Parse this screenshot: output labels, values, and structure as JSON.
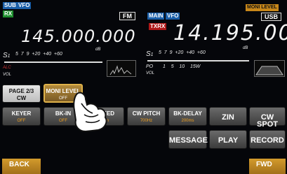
{
  "top": {
    "sub_label": "SUB",
    "sub_vfo": "VFO",
    "rx": "RX",
    "mode": "FM",
    "main_label": "MAIN",
    "main_vfo": "VFO",
    "txrx": "TXRX",
    "moni_level": "MONI LEVEL",
    "usb": "USB"
  },
  "sub_freq": "145.000.000",
  "main_freq": "14.195.000",
  "meter_sub": {
    "s": "S",
    "s_num": "1",
    "scale": [
      "3",
      "5",
      "7",
      "9",
      "+20",
      "+40",
      "+60"
    ],
    "db": "dB",
    "alc": "ALC",
    "vol": "VOL"
  },
  "meter_main": {
    "s": "S",
    "s_num": "1",
    "scale": [
      "3",
      "5",
      "7",
      "9",
      "+20",
      "+40",
      "+60"
    ],
    "db": "dB",
    "po": "PO",
    "po_scale": [
      "1",
      "5",
      "10",
      "15"
    ],
    "w": "W",
    "vol": "VOL"
  },
  "row1": {
    "page_title": "PAGE 2/3",
    "page_sub": "CW",
    "moni_title": "MONI LEVEL",
    "moni_value": "OFF"
  },
  "row2": [
    {
      "label": "KEYER",
      "value": "OFF"
    },
    {
      "label": "BK-IN",
      "value": "OFF"
    },
    {
      "label": "SPEED",
      "value": "…m"
    },
    {
      "label": "CW PITCH",
      "value": "700Hz"
    },
    {
      "label": "BK-DELAY",
      "value": "200ms"
    },
    {
      "label": "ZIN",
      "value": ""
    },
    {
      "label": "CW SPOT",
      "value": ""
    }
  ],
  "row3": [
    {
      "label": "MESSAGE"
    },
    {
      "label": "PLAY"
    },
    {
      "label": "RECORD"
    }
  ],
  "nav": {
    "back": "BACK",
    "fwd": "FWD"
  }
}
